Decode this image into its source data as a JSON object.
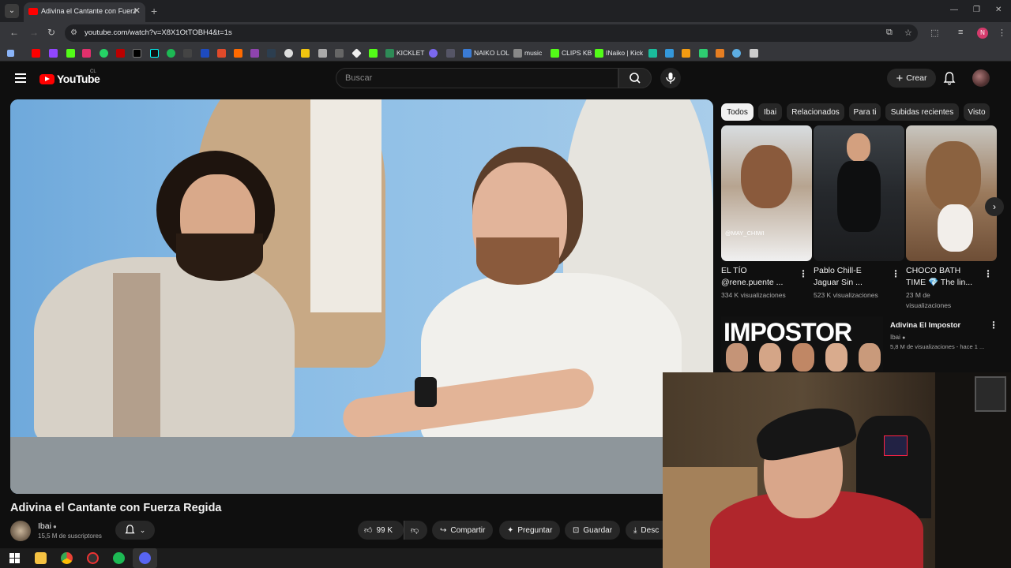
{
  "browser": {
    "tab_title": "Adivina el Cantante con Fuerza",
    "url": "youtube.com/watch?v=X8X1OtTOBH4&t=1s",
    "profile_initial": "N",
    "bookmarks": [
      "KICKLET",
      "NAIKO LOL",
      "music",
      "CLIPS KB",
      "INaiko | Kick"
    ]
  },
  "youtube": {
    "logo_text": "YouTube",
    "country_code": "CL",
    "search_placeholder": "Buscar",
    "create_label": "Crear"
  },
  "video": {
    "title": "Adivina el Cantante con Fuerza Regida",
    "channel_name": "Ibai",
    "subscribers": "15,5 M de suscriptores",
    "likes": "99 K",
    "share_label": "Compartir",
    "ask_label": "Preguntar",
    "save_label": "Guardar",
    "download_label": "Desc"
  },
  "sidebar": {
    "chips": [
      "Todos",
      "Ibai",
      "Relacionados",
      "Para ti",
      "Subidas recientes",
      "Visto"
    ],
    "shorts": [
      {
        "title": "EL TÍO @rene.puente ...",
        "views": "334 K visualizaciones",
        "overlay": "@MAY_CHIWI"
      },
      {
        "title": "Pablo Chill-E Jaguar Sin ...",
        "views": "523 K visualizaciones"
      },
      {
        "title": "CHOCO BATH TIME 💎 The lin...",
        "views": "23 M de visualizaciones"
      }
    ],
    "recommended": {
      "thumb_text": "IMPOSTOR",
      "title": "Adivina El Impostor",
      "channel": "Ibai",
      "meta": "5,8 M de visualizaciones - hace 1 ..."
    }
  },
  "colors": {
    "yt_red": "#ff0000",
    "background": "#0f0f0f",
    "chip_bg": "#272727"
  }
}
